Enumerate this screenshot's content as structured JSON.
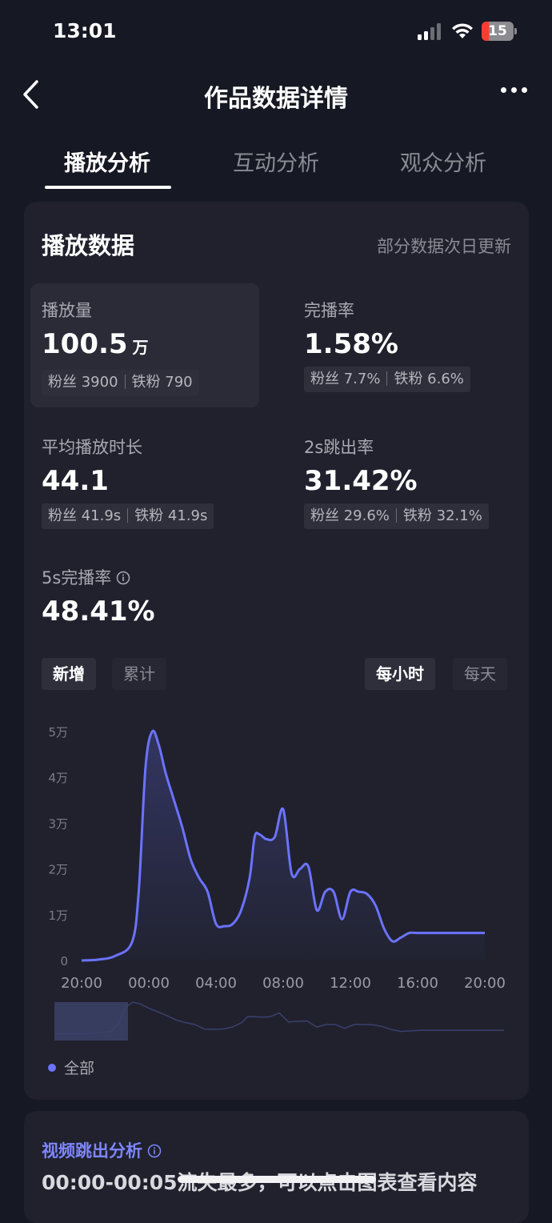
{
  "status_bar": {
    "time": "13:01",
    "battery": "15"
  },
  "nav": {
    "title": "作品数据详情"
  },
  "tabs": [
    {
      "label": "播放分析",
      "active": true
    },
    {
      "label": "互动分析",
      "active": false
    },
    {
      "label": "观众分析",
      "active": false
    }
  ],
  "play_card": {
    "title": "播放数据",
    "note": "部分数据次日更新",
    "metrics": {
      "plays": {
        "label": "播放量",
        "value": "100.5",
        "unit": "万",
        "fans": "粉丝 3900",
        "iron": "铁粉 790"
      },
      "completion": {
        "label": "完播率",
        "value": "1.58%",
        "fans": "粉丝 7.7%",
        "iron": "铁粉 6.6%"
      },
      "avg_duration": {
        "label": "平均播放时长",
        "value": "44.1",
        "fans": "粉丝 41.9s",
        "iron": "铁粉 41.9s"
      },
      "bounce": {
        "label": "2s跳出率",
        "value": "31.42%",
        "fans": "粉丝 29.6%",
        "iron": "铁粉 32.1%"
      },
      "five_s": {
        "label": "5s完播率",
        "value": "48.41%"
      }
    },
    "toggles": {
      "new": "新增",
      "cumulative": "累计",
      "hourly": "每小时",
      "daily": "每天"
    },
    "legend": "全部"
  },
  "chart_data": {
    "type": "line",
    "series": [
      {
        "name": "全部",
        "x": [
          0,
          1,
          2,
          3,
          3.4,
          3.8,
          4.2,
          4.6,
          5,
          5.5,
          6,
          6.5,
          7,
          7.5,
          8,
          8.5,
          9,
          9.5,
          10,
          10.3,
          10.6,
          11,
          11.5,
          12,
          12.5,
          13,
          13.5,
          14,
          14.5,
          15,
          15.5,
          16,
          16.5,
          17,
          17.5,
          18,
          18.5,
          19,
          19.5,
          20,
          20.5,
          21,
          21.5,
          22,
          22.5,
          23,
          23.5,
          24
        ],
        "y": [
          0,
          0.02,
          0.1,
          0.4,
          1.5,
          4.2,
          5.0,
          4.7,
          4.1,
          3.5,
          2.9,
          2.2,
          1.8,
          1.5,
          0.8,
          0.75,
          0.8,
          1.1,
          1.8,
          2.7,
          2.75,
          2.65,
          2.7,
          3.3,
          1.9,
          2.0,
          2.05,
          1.1,
          1.5,
          1.5,
          0.9,
          1.5,
          1.5,
          1.45,
          1.2,
          0.7,
          0.42,
          0.5,
          0.6,
          0.6,
          0.6,
          0.6,
          0.6,
          0.6,
          0.6,
          0.6,
          0.6,
          0.6
        ]
      }
    ],
    "x_ticks": [
      "20:00",
      "00:00",
      "04:00",
      "08:00",
      "12:00",
      "16:00",
      "20:00"
    ],
    "y_ticks": [
      "0",
      "1万",
      "2万",
      "3万",
      "4万",
      "5万"
    ],
    "ylim": [
      0,
      5
    ],
    "y_unit": "万",
    "grid": false,
    "color": "#6b73ff"
  },
  "bounce_card": {
    "title": "视频跳出分析",
    "text": "00:00-00:05流失最多，可以点击图表查看内容"
  }
}
